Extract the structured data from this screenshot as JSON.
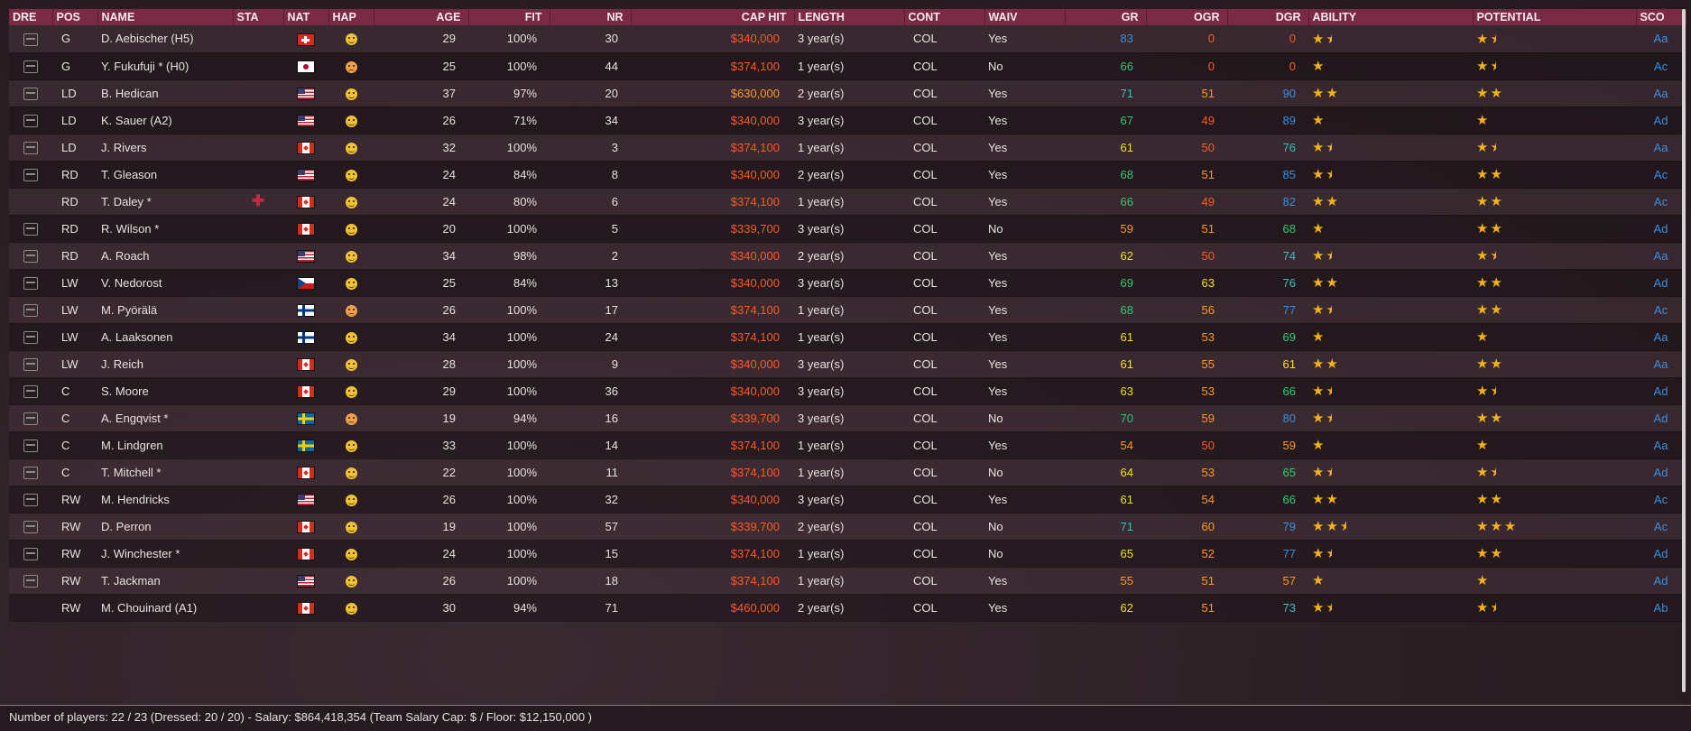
{
  "headers": [
    "DRE",
    "POS",
    "NAME",
    "STA",
    "NAT",
    "HAP",
    "AGE",
    "FIT",
    "NR",
    "CAP HIT",
    "LENGTH",
    "CONT",
    "WAIV",
    "GR",
    "OGR",
    "DGR",
    "ABILITY",
    "POTENTIAL",
    "SCO"
  ],
  "colors": {
    "header": "#7a2a45",
    "cap_high": "#ff5a1f",
    "cap_mid": "#ff9a1f",
    "star": "#f2b21a",
    "scout": "#3a8fe0",
    "injury": "#c8283c"
  },
  "rows": [
    {
      "dressed": true,
      "pos": "G",
      "name": "D. Aebischer (H5)",
      "sta": "",
      "nat": "flag-ch",
      "hap": "happy",
      "age": "29",
      "fit": "100%",
      "nr": "30",
      "cap": "$340,000",
      "len": "3 year(s)",
      "cont": "COL",
      "waiv": "Yes",
      "gr": "83",
      "grc": "#3a8fe0",
      "ogr": "0",
      "ogrc": "#ff5a1f",
      "dgr": "0",
      "dgrc": "#ff5a1f",
      "ability": "★",
      "ability_half": true,
      "potential": "★",
      "potential_half": true,
      "sco": "Aa"
    },
    {
      "dressed": true,
      "pos": "G",
      "name": "Y. Fukufuji * (H0)",
      "sta": "",
      "nat": "flag-jp",
      "hap": "sad",
      "age": "25",
      "fit": "100%",
      "nr": "44",
      "cap": "$374,100",
      "len": "1 year(s)",
      "cont": "COL",
      "waiv": "No",
      "gr": "66",
      "grc": "#2ecc71",
      "ogr": "0",
      "ogrc": "#ff5a1f",
      "dgr": "0",
      "dgrc": "#ff5a1f",
      "ability": "★",
      "ability_half": false,
      "potential": "★",
      "potential_half": true,
      "sco": "Ac"
    },
    {
      "dressed": true,
      "pos": "LD",
      "name": "B. Hedican",
      "sta": "",
      "nat": "flag-us",
      "hap": "happy",
      "age": "37",
      "fit": "97%",
      "nr": "20",
      "cap": "$630,000",
      "capmid": true,
      "len": "2 year(s)",
      "cont": "COL",
      "waiv": "Yes",
      "gr": "71",
      "grc": "#3ac0c0",
      "ogr": "51",
      "ogrc": "#ff9a1f",
      "dgr": "90",
      "dgrc": "#3a8fe0",
      "ability": "★★",
      "ability_half": false,
      "potential": "★★",
      "potential_half": false,
      "sco": "Aa"
    },
    {
      "dressed": true,
      "pos": "LD",
      "name": "K. Sauer (A2)",
      "sta": "",
      "nat": "flag-us",
      "hap": "happy",
      "age": "26",
      "fit": "71%",
      "nr": "34",
      "cap": "$340,000",
      "len": "3 year(s)",
      "cont": "COL",
      "waiv": "Yes",
      "gr": "67",
      "grc": "#2ecc71",
      "ogr": "49",
      "ogrc": "#ff5a1f",
      "dgr": "89",
      "dgrc": "#3a8fe0",
      "ability": "★",
      "ability_half": false,
      "potential": "★",
      "potential_half": false,
      "sco": "Ad"
    },
    {
      "dressed": true,
      "pos": "LD",
      "name": "J. Rivers",
      "sta": "",
      "nat": "flag-ca",
      "hap": "happy",
      "age": "32",
      "fit": "100%",
      "nr": "3",
      "cap": "$374,100",
      "len": "1 year(s)",
      "cont": "COL",
      "waiv": "Yes",
      "gr": "61",
      "grc": "#f2e21a",
      "ogr": "50",
      "ogrc": "#ff5a1f",
      "dgr": "76",
      "dgrc": "#3ac0c0",
      "ability": "★",
      "ability_half": true,
      "potential": "★",
      "potential_half": true,
      "sco": "Aa"
    },
    {
      "dressed": true,
      "pos": "RD",
      "name": "T. Gleason",
      "sta": "",
      "nat": "flag-us",
      "hap": "happy",
      "age": "24",
      "fit": "84%",
      "nr": "8",
      "cap": "$340,000",
      "len": "2 year(s)",
      "cont": "COL",
      "waiv": "Yes",
      "gr": "68",
      "grc": "#2ecc71",
      "ogr": "51",
      "ogrc": "#ff9a1f",
      "dgr": "85",
      "dgrc": "#3a8fe0",
      "ability": "★",
      "ability_half": true,
      "potential": "★★",
      "potential_half": false,
      "sco": "Ac"
    },
    {
      "dressed": false,
      "pos": "RD",
      "name": "T. Daley *",
      "sta": "✚",
      "nat": "flag-ca",
      "hap": "happy",
      "age": "24",
      "fit": "80%",
      "nr": "6",
      "cap": "$374,100",
      "len": "1 year(s)",
      "cont": "COL",
      "waiv": "Yes",
      "gr": "66",
      "grc": "#2ecc71",
      "ogr": "49",
      "ogrc": "#ff5a1f",
      "dgr": "82",
      "dgrc": "#3a8fe0",
      "ability": "★★",
      "ability_half": false,
      "potential": "★★",
      "potential_half": false,
      "sco": "Ac"
    },
    {
      "dressed": true,
      "pos": "RD",
      "name": "R. Wilson *",
      "sta": "",
      "nat": "flag-ca",
      "hap": "happy",
      "age": "20",
      "fit": "100%",
      "nr": "5",
      "cap": "$339,700",
      "len": "3 year(s)",
      "cont": "COL",
      "waiv": "No",
      "gr": "59",
      "grc": "#ff9a1f",
      "ogr": "51",
      "ogrc": "#ff9a1f",
      "dgr": "68",
      "dgrc": "#2ecc71",
      "ability": "★",
      "ability_half": false,
      "potential": "★★",
      "potential_half": false,
      "sco": "Ad"
    },
    {
      "dressed": true,
      "pos": "RD",
      "name": "A. Roach",
      "sta": "",
      "nat": "flag-us",
      "hap": "happy",
      "age": "34",
      "fit": "98%",
      "nr": "2",
      "cap": "$340,000",
      "len": "2 year(s)",
      "cont": "COL",
      "waiv": "Yes",
      "gr": "62",
      "grc": "#f2e21a",
      "ogr": "50",
      "ogrc": "#ff5a1f",
      "dgr": "74",
      "dgrc": "#3ac0c0",
      "ability": "★",
      "ability_half": true,
      "potential": "★",
      "potential_half": true,
      "sco": "Aa"
    },
    {
      "dressed": true,
      "pos": "LW",
      "name": "V. Nedorost",
      "sta": "",
      "nat": "flag-cz",
      "hap": "happy",
      "age": "25",
      "fit": "84%",
      "nr": "13",
      "cap": "$340,000",
      "len": "3 year(s)",
      "cont": "COL",
      "waiv": "Yes",
      "gr": "69",
      "grc": "#2ecc71",
      "ogr": "63",
      "ogrc": "#f2e21a",
      "dgr": "76",
      "dgrc": "#3ac0c0",
      "ability": "★★",
      "ability_half": false,
      "potential": "★★",
      "potential_half": false,
      "sco": "Ad"
    },
    {
      "dressed": true,
      "pos": "LW",
      "name": "M. Pyörälä",
      "sta": "",
      "nat": "flag-fi",
      "hap": "sad",
      "age": "26",
      "fit": "100%",
      "nr": "17",
      "cap": "$374,100",
      "len": "1 year(s)",
      "cont": "COL",
      "waiv": "Yes",
      "gr": "68",
      "grc": "#2ecc71",
      "ogr": "56",
      "ogrc": "#ff9a1f",
      "dgr": "77",
      "dgrc": "#3a8fe0",
      "ability": "★",
      "ability_half": true,
      "potential": "★★",
      "potential_half": false,
      "sco": "Ac"
    },
    {
      "dressed": true,
      "pos": "LW",
      "name": "A. Laaksonen",
      "sta": "",
      "nat": "flag-fi",
      "hap": "happy",
      "age": "34",
      "fit": "100%",
      "nr": "24",
      "cap": "$374,100",
      "len": "1 year(s)",
      "cont": "COL",
      "waiv": "Yes",
      "gr": "61",
      "grc": "#f2e21a",
      "ogr": "53",
      "ogrc": "#ff9a1f",
      "dgr": "69",
      "dgrc": "#2ecc71",
      "ability": "★",
      "ability_half": false,
      "potential": "★",
      "potential_half": false,
      "sco": "Aa"
    },
    {
      "dressed": true,
      "pos": "LW",
      "name": "J. Reich",
      "sta": "",
      "nat": "flag-ca",
      "hap": "happy",
      "age": "28",
      "fit": "100%",
      "nr": "9",
      "cap": "$340,000",
      "len": "3 year(s)",
      "cont": "COL",
      "waiv": "Yes",
      "gr": "61",
      "grc": "#f2e21a",
      "ogr": "55",
      "ogrc": "#ff9a1f",
      "dgr": "61",
      "dgrc": "#f2e21a",
      "ability": "★★",
      "ability_half": false,
      "potential": "★★",
      "potential_half": false,
      "sco": "Aa"
    },
    {
      "dressed": true,
      "pos": "C",
      "name": "S. Moore",
      "sta": "",
      "nat": "flag-ca",
      "hap": "happy",
      "age": "29",
      "fit": "100%",
      "nr": "36",
      "cap": "$340,000",
      "len": "3 year(s)",
      "cont": "COL",
      "waiv": "Yes",
      "gr": "63",
      "grc": "#f2e21a",
      "ogr": "53",
      "ogrc": "#ff9a1f",
      "dgr": "66",
      "dgrc": "#2ecc71",
      "ability": "★",
      "ability_half": true,
      "potential": "★",
      "potential_half": true,
      "sco": "Ad"
    },
    {
      "dressed": true,
      "pos": "C",
      "name": "A. Engqvist *",
      "sta": "",
      "nat": "flag-se",
      "hap": "sad",
      "age": "19",
      "fit": "94%",
      "nr": "16",
      "cap": "$339,700",
      "len": "3 year(s)",
      "cont": "COL",
      "waiv": "No",
      "gr": "70",
      "grc": "#2ecc71",
      "ogr": "59",
      "ogrc": "#ff9a1f",
      "dgr": "80",
      "dgrc": "#3a8fe0",
      "ability": "★",
      "ability_half": true,
      "potential": "★★",
      "potential_half": false,
      "sco": "Ad"
    },
    {
      "dressed": true,
      "pos": "C",
      "name": "M. Lindgren",
      "sta": "",
      "nat": "flag-se",
      "hap": "happy",
      "age": "33",
      "fit": "100%",
      "nr": "14",
      "cap": "$374,100",
      "len": "1 year(s)",
      "cont": "COL",
      "waiv": "Yes",
      "gr": "54",
      "grc": "#ff9a1f",
      "ogr": "50",
      "ogrc": "#ff5a1f",
      "dgr": "59",
      "dgrc": "#ff9a1f",
      "ability": "★",
      "ability_half": false,
      "potential": "★",
      "potential_half": false,
      "sco": "Aa"
    },
    {
      "dressed": true,
      "pos": "C",
      "name": "T. Mitchell *",
      "sta": "",
      "nat": "flag-ca",
      "hap": "happy",
      "age": "22",
      "fit": "100%",
      "nr": "11",
      "cap": "$374,100",
      "len": "1 year(s)",
      "cont": "COL",
      "waiv": "No",
      "gr": "64",
      "grc": "#f2e21a",
      "ogr": "53",
      "ogrc": "#ff9a1f",
      "dgr": "65",
      "dgrc": "#2ecc71",
      "ability": "★",
      "ability_half": true,
      "potential": "★",
      "potential_half": true,
      "sco": "Ad"
    },
    {
      "dressed": true,
      "pos": "RW",
      "name": "M. Hendricks",
      "sta": "",
      "nat": "flag-us",
      "hap": "happy",
      "age": "26",
      "fit": "100%",
      "nr": "32",
      "cap": "$340,000",
      "len": "3 year(s)",
      "cont": "COL",
      "waiv": "Yes",
      "gr": "61",
      "grc": "#f2e21a",
      "ogr": "54",
      "ogrc": "#ff9a1f",
      "dgr": "66",
      "dgrc": "#2ecc71",
      "ability": "★★",
      "ability_half": false,
      "potential": "★★",
      "potential_half": false,
      "sco": "Ac"
    },
    {
      "dressed": true,
      "pos": "RW",
      "name": "D. Perron",
      "sta": "",
      "nat": "flag-ca",
      "hap": "happy",
      "age": "19",
      "fit": "100%",
      "nr": "57",
      "cap": "$339,700",
      "len": "2 year(s)",
      "cont": "COL",
      "waiv": "No",
      "gr": "71",
      "grc": "#3ac0c0",
      "ogr": "60",
      "ogrc": "#ff9a1f",
      "dgr": "79",
      "dgrc": "#3a8fe0",
      "ability": "★★",
      "ability_half": true,
      "potential": "★★★",
      "potential_half": false,
      "sco": "Ac"
    },
    {
      "dressed": true,
      "pos": "RW",
      "name": "J. Winchester *",
      "sta": "",
      "nat": "flag-ca",
      "hap": "happy",
      "age": "24",
      "fit": "100%",
      "nr": "15",
      "cap": "$374,100",
      "len": "1 year(s)",
      "cont": "COL",
      "waiv": "No",
      "gr": "65",
      "grc": "#f2e21a",
      "ogr": "52",
      "ogrc": "#ff9a1f",
      "dgr": "77",
      "dgrc": "#3a8fe0",
      "ability": "★",
      "ability_half": true,
      "potential": "★★",
      "potential_half": false,
      "sco": "Ad"
    },
    {
      "dressed": true,
      "pos": "RW",
      "name": "T. Jackman",
      "sta": "",
      "nat": "flag-us",
      "hap": "happy",
      "age": "26",
      "fit": "100%",
      "nr": "18",
      "cap": "$374,100",
      "len": "1 year(s)",
      "cont": "COL",
      "waiv": "Yes",
      "gr": "55",
      "grc": "#ff9a1f",
      "ogr": "51",
      "ogrc": "#ff9a1f",
      "dgr": "57",
      "dgrc": "#ff9a1f",
      "ability": "★",
      "ability_half": false,
      "potential": "★",
      "potential_half": false,
      "sco": "Ad"
    },
    {
      "dressed": false,
      "pos": "RW",
      "name": "M. Chouinard (A1)",
      "sta": "",
      "nat": "flag-ca",
      "hap": "happy",
      "age": "30",
      "fit": "94%",
      "nr": "71",
      "cap": "$460,000",
      "len": "2 year(s)",
      "cont": "COL",
      "waiv": "Yes",
      "gr": "62",
      "grc": "#f2e21a",
      "ogr": "51",
      "ogrc": "#ff9a1f",
      "dgr": "73",
      "dgrc": "#3ac0c0",
      "ability": "★",
      "ability_half": true,
      "potential": "★",
      "potential_half": true,
      "sco": "Ab"
    }
  ],
  "footer": {
    "text": "Number of players: 22 / 23 (Dressed: 20 / 20)  -   Salary: $864,418,354  (Team Salary Cap: $ / Floor: $12,150,000 )"
  }
}
